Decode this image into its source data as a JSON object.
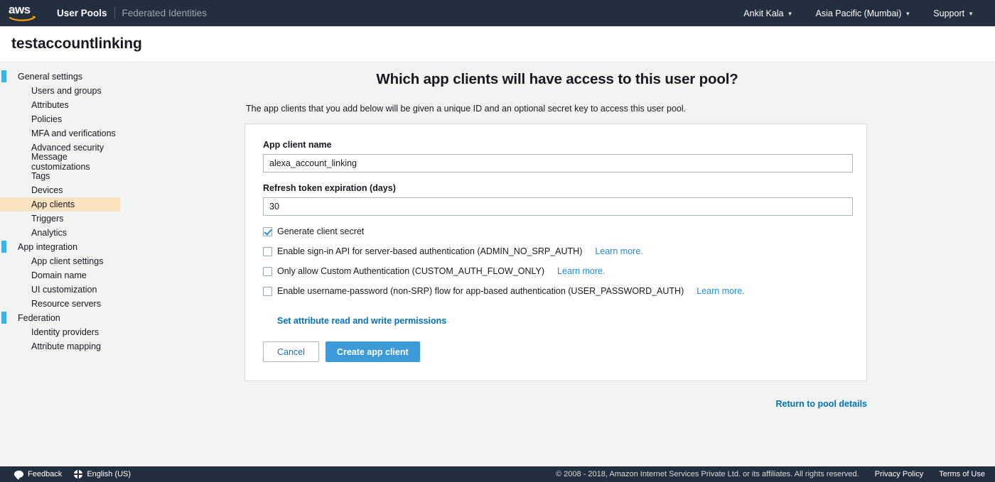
{
  "topnav": {
    "logo_alt": "aws",
    "tabs": [
      {
        "label": "User Pools",
        "active": true
      },
      {
        "label": "Federated Identities",
        "active": false
      }
    ],
    "account": "Ankit Kala",
    "region": "Asia Pacific (Mumbai)",
    "support": "Support"
  },
  "titlebar": {
    "pool_name": "testaccountlinking"
  },
  "sidebar": {
    "groups": [
      {
        "label": "General settings",
        "children": [
          {
            "label": "Users and groups",
            "selected": false
          },
          {
            "label": "Attributes",
            "selected": false
          },
          {
            "label": "Policies",
            "selected": false
          },
          {
            "label": "MFA and verifications",
            "selected": false
          },
          {
            "label": "Advanced security",
            "selected": false
          },
          {
            "label": "Message customizations",
            "selected": false
          },
          {
            "label": "Tags",
            "selected": false
          },
          {
            "label": "Devices",
            "selected": false
          },
          {
            "label": "App clients",
            "selected": true
          },
          {
            "label": "Triggers",
            "selected": false
          },
          {
            "label": "Analytics",
            "selected": false
          }
        ]
      },
      {
        "label": "App integration",
        "children": [
          {
            "label": "App client settings",
            "selected": false
          },
          {
            "label": "Domain name",
            "selected": false
          },
          {
            "label": "UI customization",
            "selected": false
          },
          {
            "label": "Resource servers",
            "selected": false
          }
        ]
      },
      {
        "label": "Federation",
        "children": [
          {
            "label": "Identity providers",
            "selected": false
          },
          {
            "label": "Attribute mapping",
            "selected": false
          }
        ]
      }
    ]
  },
  "main": {
    "heading": "Which app clients will have access to this user pool?",
    "subtitle": "The app clients that you add below will be given a unique ID and an optional secret key to access this user pool.",
    "fields": [
      {
        "label": "App client name",
        "value": "alexa_account_linking"
      },
      {
        "label": "Refresh token expiration (days)",
        "value": "30"
      }
    ],
    "checkboxes": [
      {
        "label": "Generate client secret",
        "checked": true,
        "learn_more": ""
      },
      {
        "label": "Enable sign-in API for server-based authentication (ADMIN_NO_SRP_AUTH)",
        "checked": false,
        "learn_more": "Learn more."
      },
      {
        "label": "Only allow Custom Authentication (CUSTOM_AUTH_FLOW_ONLY)",
        "checked": false,
        "learn_more": "Learn more."
      },
      {
        "label": "Enable username-password (non-SRP) flow for app-based authentication (USER_PASSWORD_AUTH)",
        "checked": false,
        "learn_more": "Learn more."
      }
    ],
    "permissions_link": "Set attribute read and write permissions",
    "cancel_label": "Cancel",
    "create_label": "Create app client",
    "return_link": "Return to pool details"
  },
  "footer": {
    "feedback": "Feedback",
    "language": "English (US)",
    "copyright": "© 2008 - 2018, Amazon Internet Services Private Ltd. or its affiliates. All rights reserved.",
    "privacy": "Privacy Policy",
    "terms": "Terms of Use"
  },
  "colors": {
    "nav_bg": "#232f3e",
    "accent_blue": "#1f8ddb",
    "primary_button": "#3d9ad9",
    "selected_nav": "#fbe2c0",
    "marker_blue": "#39b3e8",
    "page_bg": "#f2f3f3"
  }
}
